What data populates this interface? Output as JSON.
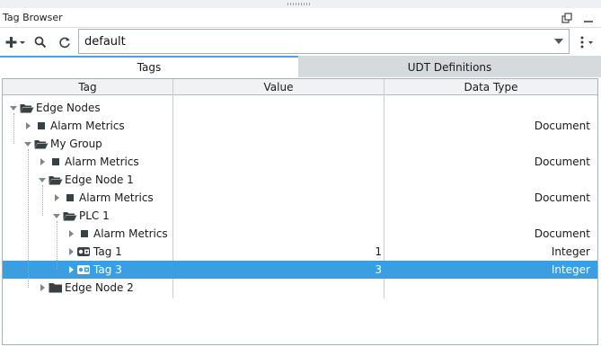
{
  "window": {
    "title": "Tag Browser"
  },
  "toolbar": {
    "add_icon": "plus-dropdown-icon",
    "search_icon": "search-icon",
    "refresh_icon": "refresh-icon",
    "provider_value": "default",
    "more_icon": "kebab-menu-icon"
  },
  "tabs": [
    {
      "label": "Tags",
      "active": true
    },
    {
      "label": "UDT Definitions",
      "active": false
    }
  ],
  "columns": {
    "tag": "Tag",
    "value": "Value",
    "type": "Data Type"
  },
  "rows": [
    {
      "label": "Edge Nodes",
      "icon": "folder-open-icon",
      "expanded": true,
      "value": "",
      "type": "",
      "selected": false
    },
    {
      "label": "Alarm Metrics",
      "icon": "document-tag-icon",
      "expanded": false,
      "value": "",
      "type": "Document",
      "selected": false
    },
    {
      "label": "My Group",
      "icon": "folder-open-icon",
      "expanded": true,
      "value": "",
      "type": "",
      "selected": false
    },
    {
      "label": "Alarm Metrics",
      "icon": "document-tag-icon",
      "expanded": false,
      "value": "",
      "type": "Document",
      "selected": false
    },
    {
      "label": "Edge Node 1",
      "icon": "folder-open-icon",
      "expanded": true,
      "value": "",
      "type": "",
      "selected": false
    },
    {
      "label": "Alarm Metrics",
      "icon": "document-tag-icon",
      "expanded": false,
      "value": "",
      "type": "Document",
      "selected": false
    },
    {
      "label": "PLC 1",
      "icon": "folder-open-icon",
      "expanded": true,
      "value": "",
      "type": "",
      "selected": false
    },
    {
      "label": "Alarm Metrics",
      "icon": "document-tag-icon",
      "expanded": false,
      "value": "",
      "type": "Document",
      "selected": false
    },
    {
      "label": "Tag 1",
      "icon": "opc-tag-icon",
      "expanded": false,
      "value": "1",
      "type": "Integer",
      "selected": false
    },
    {
      "label": "Tag 3",
      "icon": "opc-tag-icon",
      "expanded": false,
      "value": "3",
      "type": "Integer",
      "selected": true
    },
    {
      "label": "Edge Node 2",
      "icon": "folder-closed-icon",
      "expanded": false,
      "value": "",
      "type": "",
      "selected": false
    }
  ],
  "colors": {
    "selection": "#3b9ee0",
    "active_tab_accent": "#4aa3df",
    "inactive_tab": "#d6dadd"
  }
}
